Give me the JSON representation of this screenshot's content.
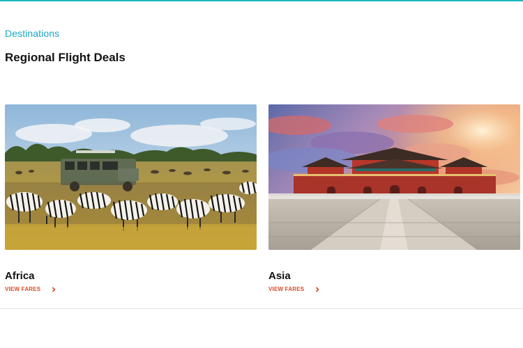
{
  "section": {
    "eyebrow": "Destinations",
    "title": "Regional Flight Deals"
  },
  "cards": [
    {
      "title": "Africa",
      "link_label": "VIEW FARES",
      "link_icon": "chevron-right-icon",
      "image_subject": "safari-zebra-photo"
    },
    {
      "title": "Asia",
      "link_label": "VIEW FARES",
      "link_icon": "chevron-right-icon",
      "image_subject": "forbidden-city-photo"
    }
  ],
  "colors": {
    "accent_teal": "#1aa8c4",
    "link_orange": "#d94b24",
    "title_dark": "#121212",
    "top_border": "#1ab8bf"
  }
}
